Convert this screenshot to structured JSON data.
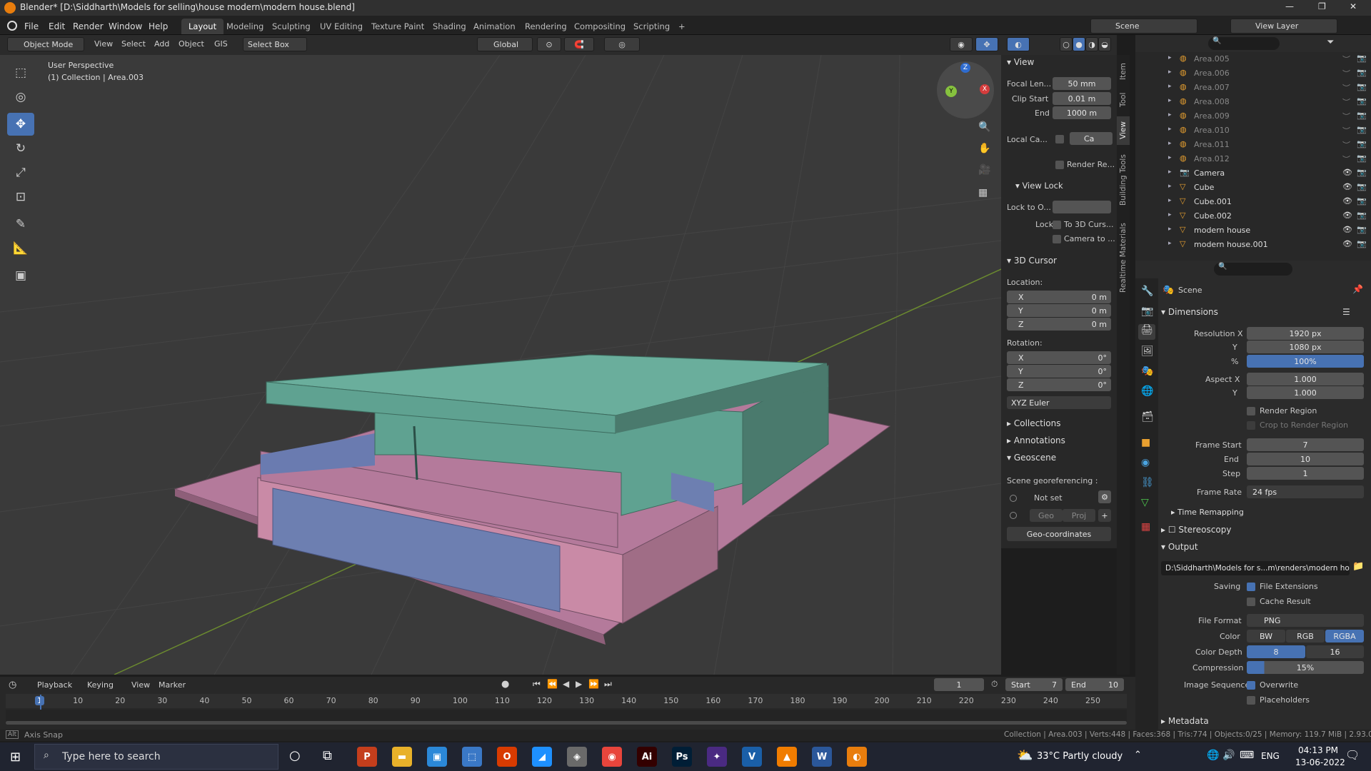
{
  "window": {
    "title": "Blender* [D:\\Siddharth\\Models for selling\\house modern\\modern house.blend]",
    "controls": [
      "—",
      "❐",
      "✕"
    ]
  },
  "menu": [
    "File",
    "Edit",
    "Render",
    "Window",
    "Help"
  ],
  "workspaces": [
    "Layout",
    "Modeling",
    "Sculpting",
    "UV Editing",
    "Texture Paint",
    "Shading",
    "Animation",
    "Rendering",
    "Compositing",
    "Scripting",
    "+"
  ],
  "scene": {
    "label": "Scene",
    "view_layer": "View Layer"
  },
  "header": {
    "mode": "Object Mode",
    "menus": [
      "View",
      "Select",
      "Add",
      "Object",
      "GIS"
    ],
    "select_box": "Select Box",
    "orientation": "Global"
  },
  "viewport": {
    "perspective": "User Perspective",
    "collection": "(1) Collection | Area.003",
    "gizmo_axes": [
      "X",
      "Y",
      "Z"
    ]
  },
  "npanel": {
    "view_title": "View",
    "focal_label": "Focal Len...",
    "focal_value": "50 mm",
    "clip_start_label": "Clip Start",
    "clip_start_value": "0.01 m",
    "clip_end_label": "End",
    "clip_end_value": "1000 m",
    "local_cam_label": "Local Ca...",
    "local_cam_value": "Ca",
    "render_region": "Render Re...",
    "view_lock_title": "View Lock",
    "lock_to_label": "Lock to O...",
    "lock_label": "Lock",
    "lock_3d_cursor": "To 3D Curs...",
    "camera_to": "Camera to ...",
    "cursor_title": "3D Cursor",
    "location_label": "Location:",
    "loc_x": "0 m",
    "loc_y": "0 m",
    "loc_z": "0 m",
    "rotation_label": "Rotation:",
    "rot_x": "0°",
    "rot_y": "0°",
    "rot_z": "0°",
    "euler": "XYZ Euler",
    "collections": "Collections",
    "annotations": "Annotations",
    "geoscene": "Geoscene",
    "georef": "Scene georeferencing :",
    "not_set": "Not set",
    "geo": "Geo",
    "proj": "Proj",
    "geo_coords": "Geo-coordinates",
    "axis_x": "X",
    "axis_y": "Y",
    "axis_z": "Z"
  },
  "sidetabs": [
    "Item",
    "Tool",
    "View",
    "Building Tools",
    "Realtime Materials"
  ],
  "outliner": [
    {
      "name": "Area.005",
      "visible": false
    },
    {
      "name": "Area.006",
      "visible": false
    },
    {
      "name": "Area.007",
      "visible": false
    },
    {
      "name": "Area.008",
      "visible": false
    },
    {
      "name": "Area.009",
      "visible": false
    },
    {
      "name": "Area.010",
      "visible": false
    },
    {
      "name": "Area.011",
      "visible": false
    },
    {
      "name": "Area.012",
      "visible": false
    },
    {
      "name": "Camera",
      "visible": true
    },
    {
      "name": "Cube",
      "visible": true
    },
    {
      "name": "Cube.001",
      "visible": true
    },
    {
      "name": "Cube.002",
      "visible": true
    },
    {
      "name": "modern house",
      "visible": true
    },
    {
      "name": "modern house.001",
      "visible": true
    }
  ],
  "properties": {
    "scene_label": "Scene",
    "dimensions": "Dimensions",
    "res_x_label": "Resolution X",
    "res_x": "1920 px",
    "res_y_label": "Y",
    "res_y": "1080 px",
    "pct_label": "%",
    "pct": "100%",
    "aspect_x_label": "Aspect X",
    "aspect_x": "1.000",
    "aspect_y_label": "Y",
    "aspect_y": "1.000",
    "render_region": "Render Region",
    "crop_region": "Crop to Render Region",
    "frame_start_label": "Frame Start",
    "frame_start": "7",
    "frame_end_label": "End",
    "frame_end": "10",
    "step_label": "Step",
    "step": "1",
    "frame_rate_label": "Frame Rate",
    "frame_rate": "24 fps",
    "time_remap": "Time Remapping",
    "stereoscopy": "Stereoscopy",
    "output": "Output",
    "output_path": "D:\\Siddharth\\Models for s...m\\renders\\modern house",
    "saving_label": "Saving",
    "file_ext": "File Extensions",
    "cache": "Cache Result",
    "file_format_label": "File Format",
    "file_format": "PNG",
    "color_label": "Color",
    "color_bw": "BW",
    "color_rgb": "RGB",
    "color_rgba": "RGBA",
    "depth_label": "Color Depth",
    "depth_8": "8",
    "depth_16": "16",
    "compression_label": "Compression",
    "compression": "15%",
    "image_seq_label": "Image Sequence",
    "overwrite": "Overwrite",
    "placeholders": "Placeholders",
    "metadata": "Metadata"
  },
  "timeline": {
    "menus": [
      "Playback",
      "Keying",
      "View",
      "Marker"
    ],
    "current_frame": "1",
    "start_label": "Start",
    "start": "7",
    "end_label": "End",
    "end": "10",
    "ruler": [
      "1",
      "10",
      "20",
      "30",
      "40",
      "50",
      "60",
      "70",
      "80",
      "90",
      "100",
      "110",
      "120",
      "130",
      "140",
      "150",
      "160",
      "170",
      "180",
      "190",
      "200",
      "210",
      "220",
      "230",
      "240",
      "250"
    ]
  },
  "status": {
    "left": "Axis Snap",
    "right": "Collection | Area.003 | Verts:448 | Faces:368 | Tris:774 | Objects:0/25 | Memory: 119.7 MiB | 2.93.0"
  },
  "taskbar": {
    "search": "Type here to search",
    "weather": "33°C  Partly cloudy",
    "lang": "ENG",
    "time": "04:13 PM",
    "date": "13-06-2022",
    "apps": [
      {
        "label": "P",
        "color": "#c43e1c"
      },
      {
        "label": "▬",
        "color": "#e8b12a"
      },
      {
        "label": "▣",
        "color": "#2b88d8"
      },
      {
        "label": "⬚",
        "color": "#3a78c6"
      },
      {
        "label": "O",
        "color": "#d83b01"
      },
      {
        "label": "◢",
        "color": "#1e90ff"
      },
      {
        "label": "◈",
        "color": "#6a6a6a"
      },
      {
        "label": "◉",
        "color": "#e8453c"
      },
      {
        "label": "Ai",
        "color": "#330000"
      },
      {
        "label": "Ps",
        "color": "#001e36"
      },
      {
        "label": "✦",
        "color": "#4a2a82"
      },
      {
        "label": "V",
        "color": "#1a5fa8"
      },
      {
        "label": "▲",
        "color": "#f07c00"
      },
      {
        "label": "W",
        "color": "#2b579a"
      },
      {
        "label": "◐",
        "color": "#e87d0d"
      }
    ]
  },
  "colors": {
    "accent": "#4772b3",
    "roof": "#5fa291",
    "base": "#b47a9b",
    "window": "#6d7fb1"
  }
}
